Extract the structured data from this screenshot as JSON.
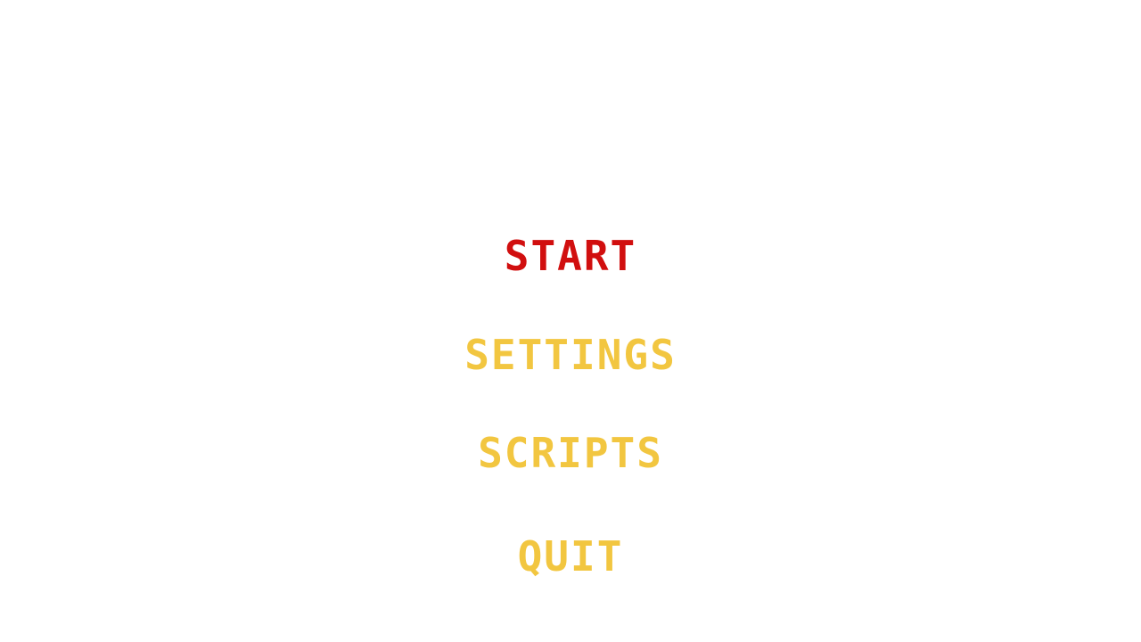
{
  "colors": {
    "background": "#ffffff",
    "selected": "#d10f0f",
    "unselected": "#f2c640"
  },
  "menu": {
    "items": [
      {
        "label": "START",
        "selected": true
      },
      {
        "label": "SETTINGS",
        "selected": false
      },
      {
        "label": "SCRIPTS",
        "selected": false
      },
      {
        "label": "QUIT",
        "selected": false
      }
    ]
  }
}
